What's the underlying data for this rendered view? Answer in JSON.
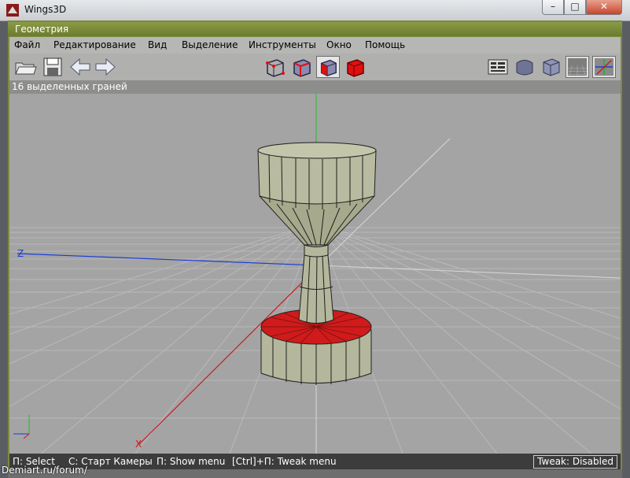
{
  "window": {
    "title": "Wings3D"
  },
  "window_buttons": {
    "minimize": "–",
    "maximize": "□",
    "close": "✕"
  },
  "geometry_panel": {
    "title": "Геометрия"
  },
  "menu": [
    "Файл",
    "Редактирование",
    "Вид",
    "Выделение",
    "Инструменты",
    "Окно",
    "Помощь"
  ],
  "toolbar": {
    "left": [
      "open-folder-icon",
      "save-disk-icon",
      "undo-arrow-icon",
      "redo-arrow-icon"
    ],
    "select_modes": [
      "vertex-mode-icon",
      "edge-mode-icon",
      "face-mode-icon",
      "object-mode-icon"
    ],
    "active_select_mode": "face-mode-icon",
    "right": [
      "workmode-icon",
      "smooth-cube-icon",
      "flat-cube-icon",
      "groundplane-icon",
      "axes-icon"
    ]
  },
  "status": {
    "selection": "16 выделенных граней"
  },
  "viewport": {
    "axis_labels": {
      "z": "Z",
      "x": "X"
    },
    "colors": {
      "background": "#a4a4a4",
      "grid": "#b8b8b8",
      "mesh_face": "#b5b89a",
      "selected_face": "#d41b1b",
      "z_axis": "#1a3dd6",
      "x_axis": "#d01818",
      "y_axis": "#2db62d"
    }
  },
  "hints": {
    "lmb": "П: Select",
    "mmb": "С: Старт Камеры",
    "rmb": "П: Show menu",
    "ctrl_rmb": "[Ctrl]+П: Tweak menu"
  },
  "tweak_status": "Tweak: Disabled",
  "watermark": "Demiart.ru/forum/"
}
